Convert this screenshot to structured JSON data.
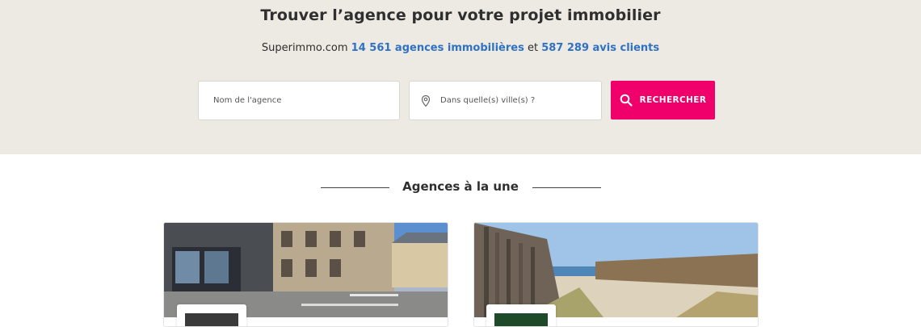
{
  "hero": {
    "title": "Trouver l’agence pour votre projet immobilier",
    "subtitle_site": "Superimmo.com",
    "subtitle_agencies": "14 561 agences immobilières",
    "subtitle_and": "et",
    "subtitle_reviews": "587 289 avis clients"
  },
  "search": {
    "agency_placeholder": "Nom de l'agence",
    "city_placeholder": "Dans quelle(s) ville(s) ?",
    "button_label": "RECHERCHER"
  },
  "featured": {
    "title": "Agences à la une",
    "cards": [
      {
        "photo": "street-building-photo",
        "logo": "agency-logo"
      },
      {
        "photo": "beach-dune-photo",
        "logo": "agency-logo"
      }
    ]
  },
  "colors": {
    "hero_bg": "#ede9e3",
    "accent": "#f0006a",
    "link_blue": "#2f72c4"
  }
}
